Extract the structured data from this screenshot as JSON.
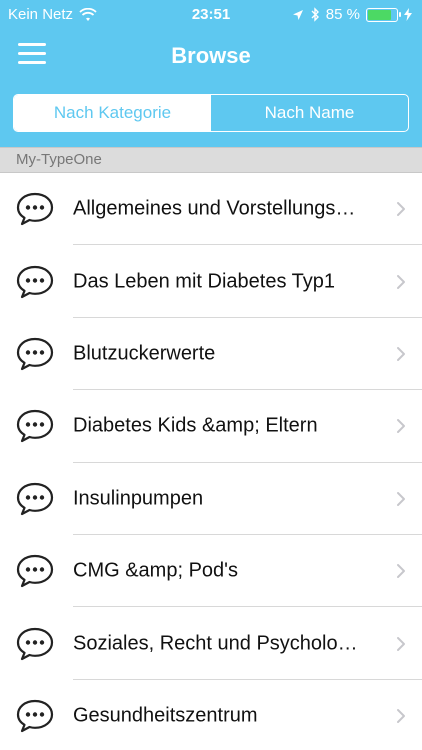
{
  "statusbar": {
    "carrier": "Kein Netz",
    "time": "23:51",
    "battery_text": "85 %",
    "battery_level": 0.85,
    "icons": [
      "wifi-icon",
      "location-arrow-icon",
      "bluetooth-icon",
      "battery-icon",
      "charging-icon"
    ]
  },
  "navbar": {
    "title": "Browse",
    "menu_icon": "hamburger-menu-icon"
  },
  "segmented": {
    "selected": "Nach Kategorie",
    "options": [
      "Nach Kategorie",
      "Nach Name"
    ]
  },
  "section": {
    "title": "My-TypeOne"
  },
  "list": {
    "row_icon": "chat-bubble-icon",
    "items": [
      {
        "label": "Allgemeines und Vorstellungs…"
      },
      {
        "label": "Das Leben mit Diabetes Typ1"
      },
      {
        "label": "Blutzuckerwerte"
      },
      {
        "label": "Diabetes Kids &amp; Eltern"
      },
      {
        "label": "Insulinpumpen"
      },
      {
        "label": "CMG &amp; Pod's"
      },
      {
        "label": "Soziales, Recht und Psycholo…"
      },
      {
        "label": "Gesundheitszentrum"
      }
    ]
  },
  "colors": {
    "accent": "#5ec8f0",
    "section_bg": "#dcdcdc",
    "battery_green": "#4cd964"
  }
}
